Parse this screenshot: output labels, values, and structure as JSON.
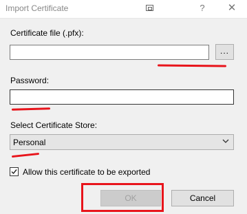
{
  "window": {
    "title": "Import Certificate",
    "help_glyph": "?",
    "close_glyph": "✕"
  },
  "form": {
    "file_label": "Certificate file (.pfx):",
    "file_value": "",
    "browse_label": "...",
    "password_label": "Password:",
    "password_value": "",
    "store_label": "Select Certificate Store:",
    "store_selected": "Personal",
    "allow_export_label": "Allow this certificate to be exported",
    "allow_export_checked": true
  },
  "buttons": {
    "ok_label": "OK",
    "cancel_label": "Cancel"
  },
  "annotation_color": "#e8141b"
}
